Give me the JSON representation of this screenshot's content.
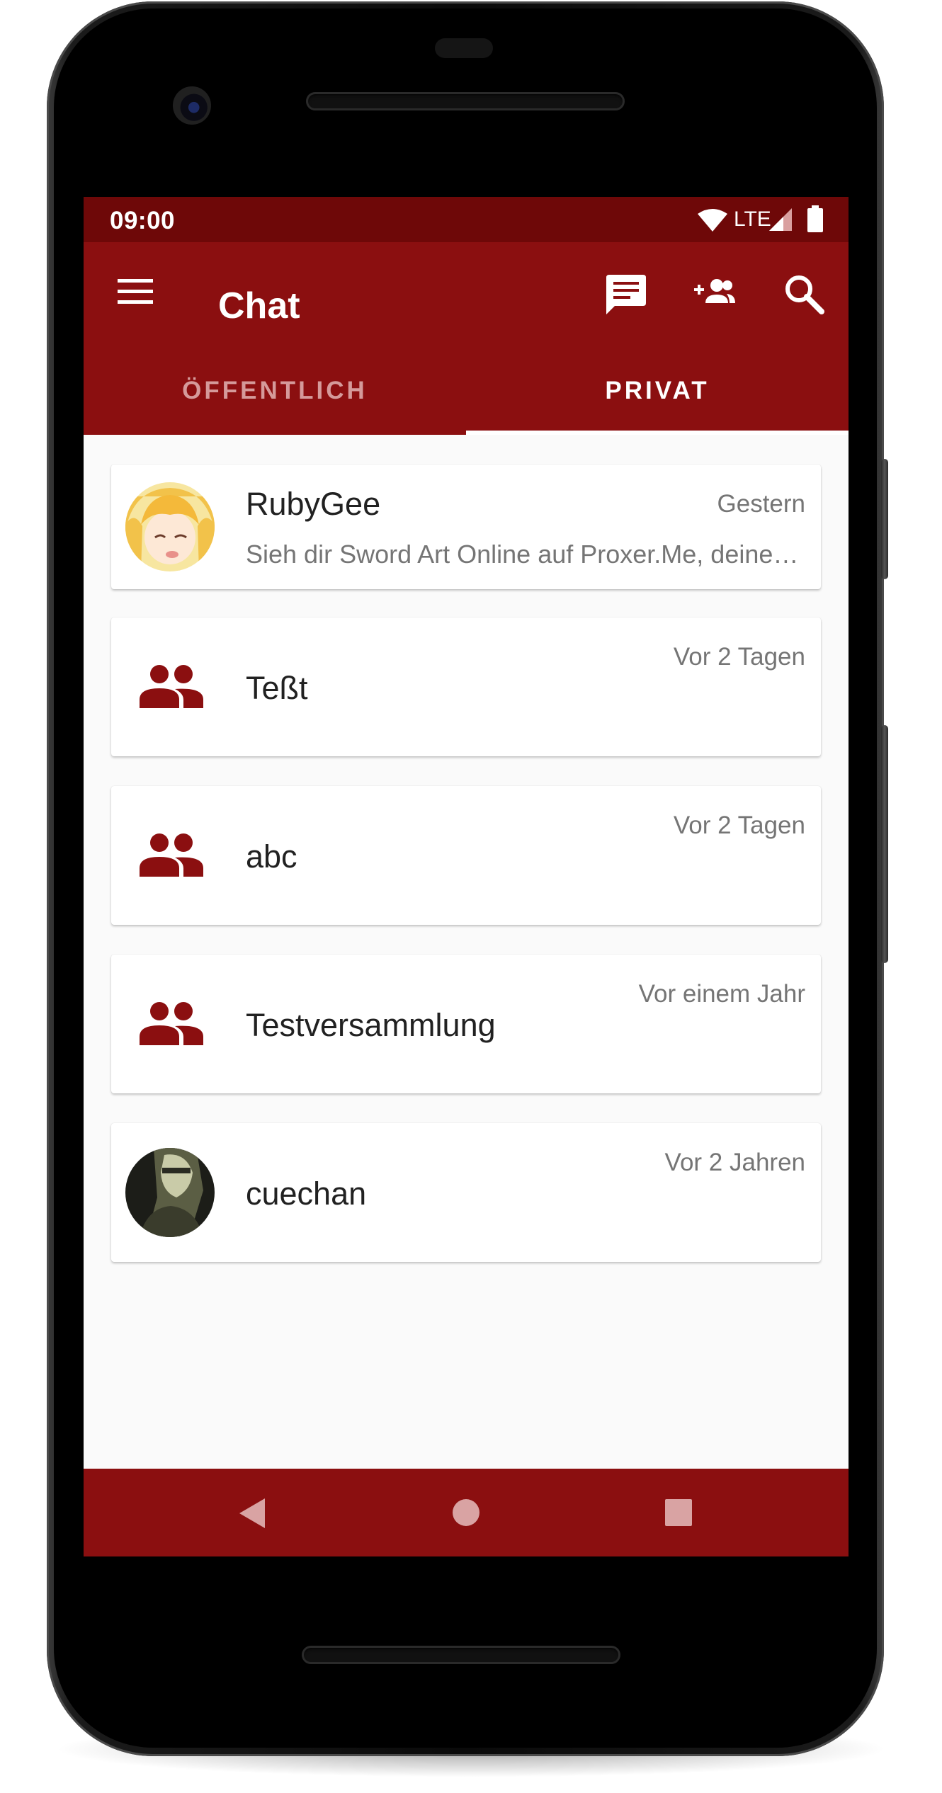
{
  "status_bar": {
    "time": "09:00",
    "network": "LTE"
  },
  "app_bar": {
    "title": "Chat",
    "icons": [
      "menu-icon",
      "new-chat-icon",
      "add-contact-icon",
      "search-icon"
    ]
  },
  "tabs": [
    {
      "label": "ÖFFENTLICH",
      "selected": false
    },
    {
      "label": "PRIVAT",
      "selected": true
    }
  ],
  "conversations": [
    {
      "name": "RubyGee",
      "time": "Gestern",
      "preview": "Sieh dir Sword Art Online auf Proxer.Me, deiner…",
      "type": "user"
    },
    {
      "name": "Teßt",
      "time": "Vor 2 Tagen",
      "type": "group"
    },
    {
      "name": "abc",
      "time": "Vor 2 Tagen",
      "type": "group"
    },
    {
      "name": "Testversammlung",
      "time": "Vor einem Jahr",
      "type": "group"
    },
    {
      "name": "cuechan",
      "time": "Vor 2 Jahren",
      "type": "user"
    }
  ],
  "nav_bar": {
    "icons": [
      "back-icon",
      "home-icon",
      "recents-icon"
    ]
  },
  "colors": {
    "primary": "#8b0f10",
    "primary_dark": "#6e0808",
    "tab_inactive": "#d59a9a",
    "secondary_text": "#757575"
  }
}
